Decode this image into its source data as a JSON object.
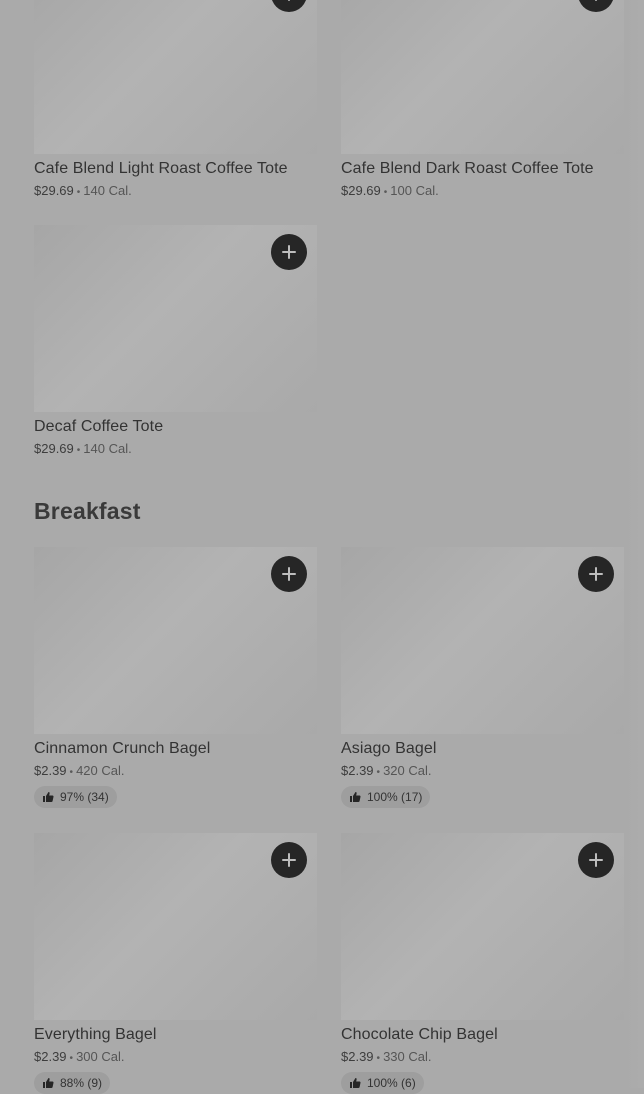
{
  "sections": {
    "coffee_totes": {
      "items": [
        {
          "name": "Cafe Blend Light Roast Coffee Tote",
          "price": "$29.69",
          "calories": "140 Cal."
        },
        {
          "name": "Cafe Blend Dark Roast Coffee Tote",
          "price": "$29.69",
          "calories": "100 Cal."
        },
        {
          "name": "Decaf Coffee Tote",
          "price": "$29.69",
          "calories": "140 Cal."
        }
      ]
    },
    "breakfast": {
      "title": "Breakfast",
      "items": [
        {
          "name": "Cinnamon Crunch Bagel",
          "price": "$2.39",
          "calories": "420 Cal.",
          "rating": "97% (34)"
        },
        {
          "name": "Asiago Bagel",
          "price": "$2.39",
          "calories": "320 Cal.",
          "rating": "100% (17)"
        },
        {
          "name": "Everything Bagel",
          "price": "$2.39",
          "calories": "300 Cal.",
          "rating": "88% (9)"
        },
        {
          "name": "Chocolate Chip Bagel",
          "price": "$2.39",
          "calories": "330 Cal.",
          "rating": "100% (6)"
        }
      ]
    }
  },
  "ui": {
    "separator": "•",
    "add_icon": "plus-icon",
    "rating_icon": "thumbs-up-icon"
  },
  "colors": {
    "background": "#aaaaaa",
    "add_button": "#262626",
    "rating_pill": "#9e9e9e",
    "text": "#333333"
  }
}
